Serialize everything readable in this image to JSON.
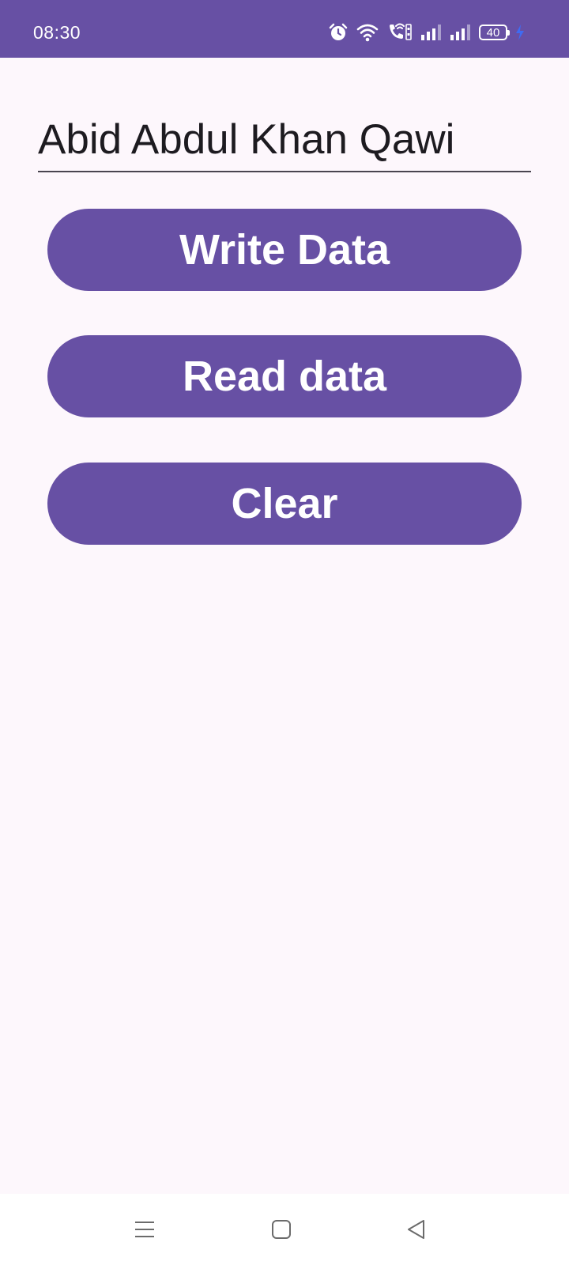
{
  "status_bar": {
    "time": "08:30",
    "battery_level": "40",
    "icons": [
      "alarm-icon",
      "wifi-icon",
      "volte-call-icon",
      "signal-icon-1",
      "signal-icon-2",
      "battery-icon",
      "charging-icon"
    ],
    "background_color": "#6750A4"
  },
  "form": {
    "name_value": "Abid Abdul Khan Qawi"
  },
  "buttons": {
    "write_label": "Write Data",
    "read_label": "Read data",
    "clear_label": "Clear",
    "color": "#6750A4"
  },
  "nav_bar": {
    "icons": [
      "recent-apps-icon",
      "home-icon",
      "back-icon"
    ]
  }
}
